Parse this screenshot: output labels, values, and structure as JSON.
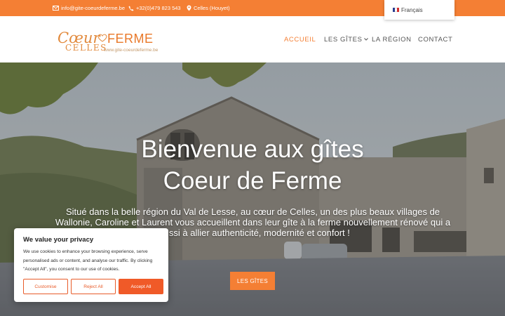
{
  "topbar": {
    "email": "info@gite-coeurdeferme.be",
    "phone": "+32(0)479 823 543",
    "location": "Celles (Houyet)",
    "icons": [
      "envelope-icon",
      "phone-icon",
      "map-pin-icon"
    ]
  },
  "language": {
    "label": "Français",
    "flag": "france-flag-icon"
  },
  "logo": {
    "coeur": "Cœur",
    "ferme": "FERME",
    "celles": "CELLES",
    "url": "www.gite-coeurdeferme.be"
  },
  "nav": {
    "items": [
      {
        "label": "ACCUEIL",
        "active": true
      },
      {
        "label": "LES GÎTES",
        "has_dropdown": true
      },
      {
        "label": "LA RÉGION"
      },
      {
        "label": "CONTACT"
      }
    ]
  },
  "hero": {
    "title_line1": "Bienvenue aux gîtes",
    "title_line2": "Coeur de Ferme",
    "subtitle": "Situé dans la belle région du Val de Lesse, au cœur de Celles, un des plus beaux villages de Wallonie, Caroline et Laurent vous accueillent dans leur gîte à la ferme nouvellement rénové qui a réussi à allier authenticité, modernité et confort !",
    "button": "LES GÎTES"
  },
  "cookie": {
    "title": "We value your privacy",
    "text": "We use cookies to enhance your browsing experience, serve personalised ads or content, and analyse our traffic. By clicking \"Accept All\", you consent to our use of cookies.",
    "customise": "Customise",
    "reject": "Reject All",
    "accept": "Accept All"
  },
  "colors": {
    "accent": "#f47f34",
    "cookie_accent": "#f05a28"
  }
}
